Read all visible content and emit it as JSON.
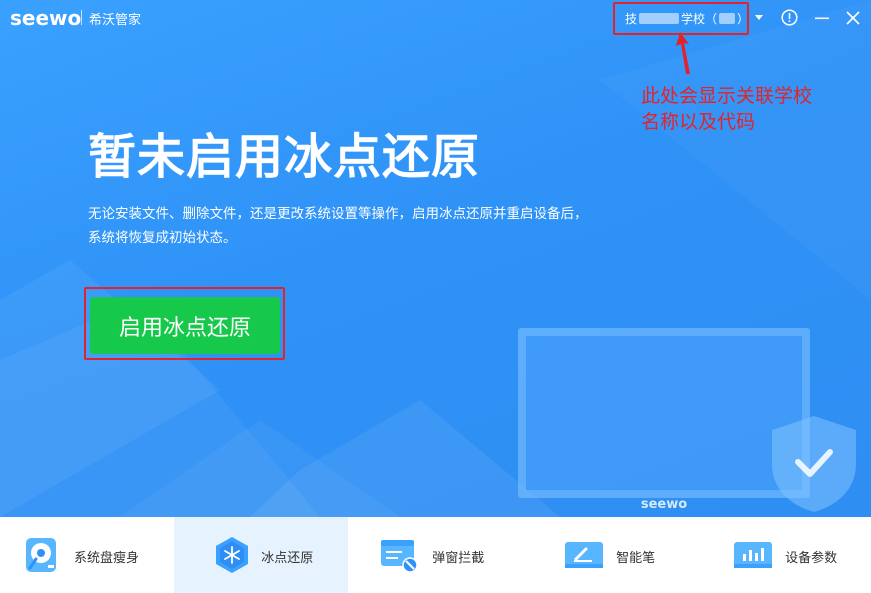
{
  "titlebar": {
    "logo": "seewo",
    "app_name": "希沃管家",
    "school_prefix": "技",
    "school_suffix": "学校（",
    "school_end": "）"
  },
  "annotation": {
    "line1": "此处会显示关联学校",
    "line2": "名称以及代码"
  },
  "hero": {
    "headline": "暂未启用冰点还原",
    "description_line1": "无论安装文件、删除文件，还是更改系统设置等操作，启用冰点还原并重启设备后，",
    "description_line2": "系统将恢复成初始状态。",
    "enable_button": "启用冰点还原",
    "monitor_brand": "seewo"
  },
  "nav": {
    "items": [
      {
        "label": "系统盘瘦身",
        "icon": "disk-icon",
        "active": false
      },
      {
        "label": "冰点还原",
        "icon": "snowflake-icon",
        "active": true
      },
      {
        "label": "弹窗拦截",
        "icon": "popup-block-icon",
        "active": false
      },
      {
        "label": "智能笔",
        "icon": "pen-icon",
        "active": false
      },
      {
        "label": "设备参数",
        "icon": "chart-icon",
        "active": false
      }
    ]
  },
  "colors": {
    "accent": "#2f92f7",
    "button": "#17c94a",
    "annotation": "#e2232a"
  }
}
